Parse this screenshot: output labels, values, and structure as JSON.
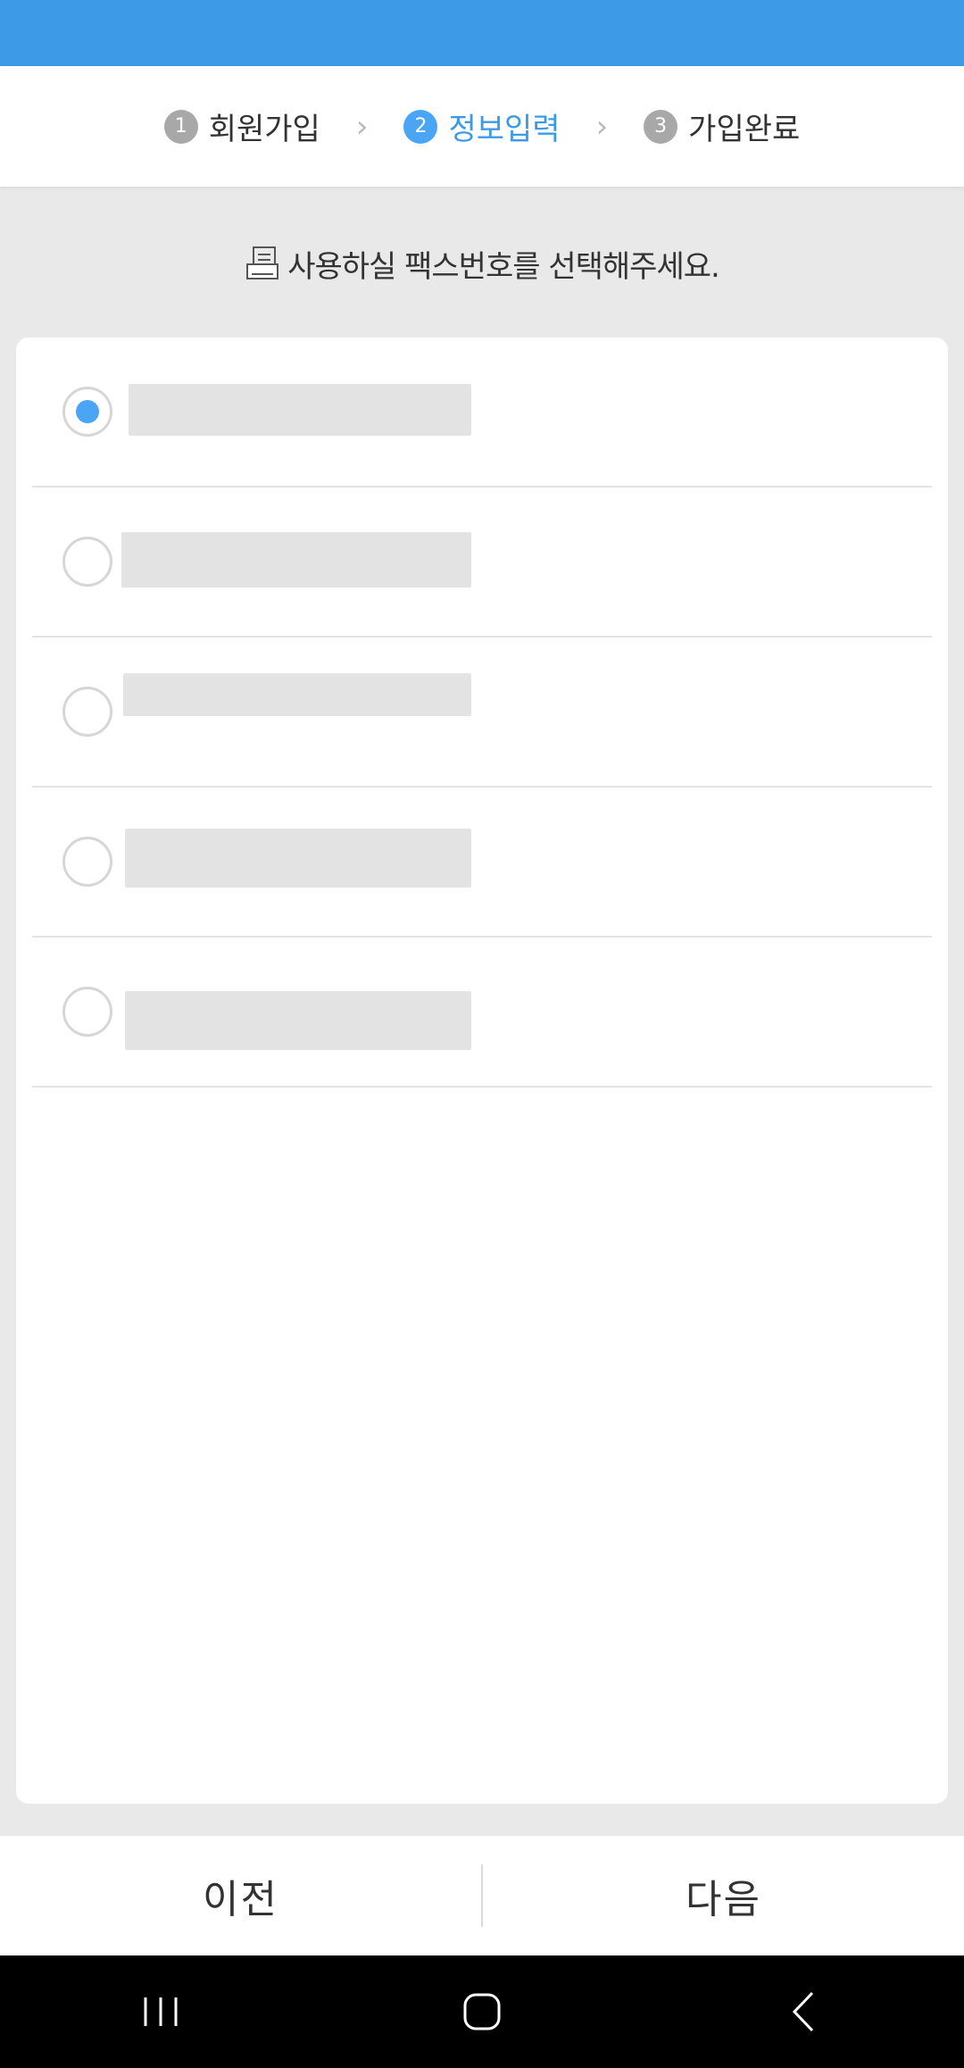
{
  "steps": [
    {
      "num": "1",
      "label": "회원가입"
    },
    {
      "num": "2",
      "label": "정보입력"
    },
    {
      "num": "3",
      "label": "가입완료"
    }
  ],
  "step_separator": "›",
  "instruction": "사용하실 팩스번호를 선택해주세요.",
  "options": [
    {
      "selected": true
    },
    {
      "selected": false
    },
    {
      "selected": false
    },
    {
      "selected": false
    },
    {
      "selected": false
    }
  ],
  "bottom": {
    "prev_label": "이전",
    "next_label": "다음"
  },
  "colors": {
    "accent": "#3d9ae6",
    "radio_selected": "#4aa6f5"
  }
}
